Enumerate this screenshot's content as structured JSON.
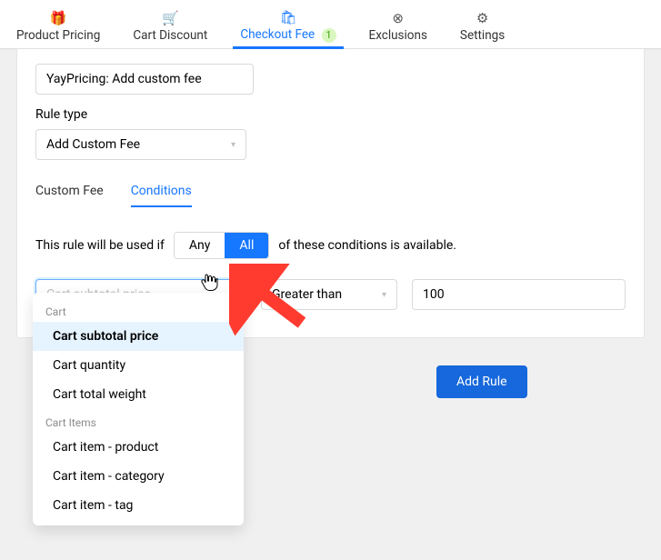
{
  "nav": {
    "items": [
      {
        "label": "Product Pricing",
        "icon": "🎁"
      },
      {
        "label": "Cart Discount",
        "icon": "🛒"
      },
      {
        "label": "Checkout Fee",
        "icon": "🛍",
        "badge": "1"
      },
      {
        "label": "Exclusions",
        "icon": "⊗"
      },
      {
        "label": "Settings",
        "icon": "⚙"
      }
    ]
  },
  "rule_name": "YayPricing: Add custom fee",
  "rule_type_label": "Rule type",
  "rule_type_value": "Add Custom Fee",
  "subtabs": [
    {
      "label": "Custom Fee"
    },
    {
      "label": "Conditions"
    }
  ],
  "cond_text_left": "This rule will be used if",
  "cond_any": "Any",
  "cond_all": "All",
  "cond_text_right": "of these conditions is available.",
  "filter_select_placeholder": "Cart subtotal price",
  "comparator_value": "Greater than",
  "value_input": "100",
  "dropdown": {
    "groups": [
      {
        "label": "Cart",
        "options": [
          "Cart subtotal price",
          "Cart quantity",
          "Cart total weight"
        ]
      },
      {
        "label": "Cart Items",
        "options": [
          "Cart item - product",
          "Cart item - category",
          "Cart item - tag"
        ]
      }
    ]
  },
  "add_rule_label": "Add Rule"
}
